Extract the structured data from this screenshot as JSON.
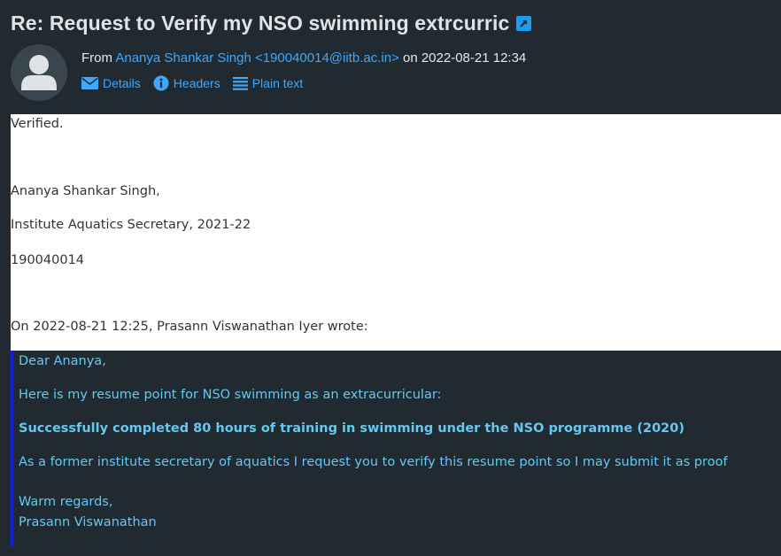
{
  "header": {
    "subject": "Re: Request to Verify my NSO swimming extrcurric",
    "from_label": "From",
    "from_name_email": "Ananya Shankar Singh <190040014@iitb.ac.in>",
    "on_label": "on",
    "date": "2022-08-21 12:34",
    "actions": {
      "details": "Details",
      "headers": "Headers",
      "plain_text": "Plain text"
    }
  },
  "message": {
    "lines": [
      "Verified.",
      "Ananya Shankar Singh,",
      "Institute Aquatics Secretary, 2021-22",
      "190040014",
      "On 2022-08-21 12:25, Prasann Viswanathan Iyer wrote:"
    ],
    "quoted": {
      "greeting": "Dear Ananya,",
      "intro": "Here is my resume point for NSO swimming as an extracurricular:",
      "resume_point": "Successfully completed 80 hours of training in swimming under the NSO programme (2020)",
      "request": "As a former institute secretary of aquatics I request you to verify this resume point so I may submit it as proof",
      "closing": "Warm regards,",
      "signature": "Prasann Viswanathan"
    }
  },
  "colors": {
    "background": "#212a30",
    "link": "#3ea8ff",
    "quote_text": "#63c8f2",
    "quote_border": "#1a1fd1"
  },
  "icons": {
    "external": "external-link-icon",
    "avatar": "user-avatar-icon",
    "details": "envelope-icon",
    "headers": "info-icon",
    "plain_text": "list-icon"
  }
}
